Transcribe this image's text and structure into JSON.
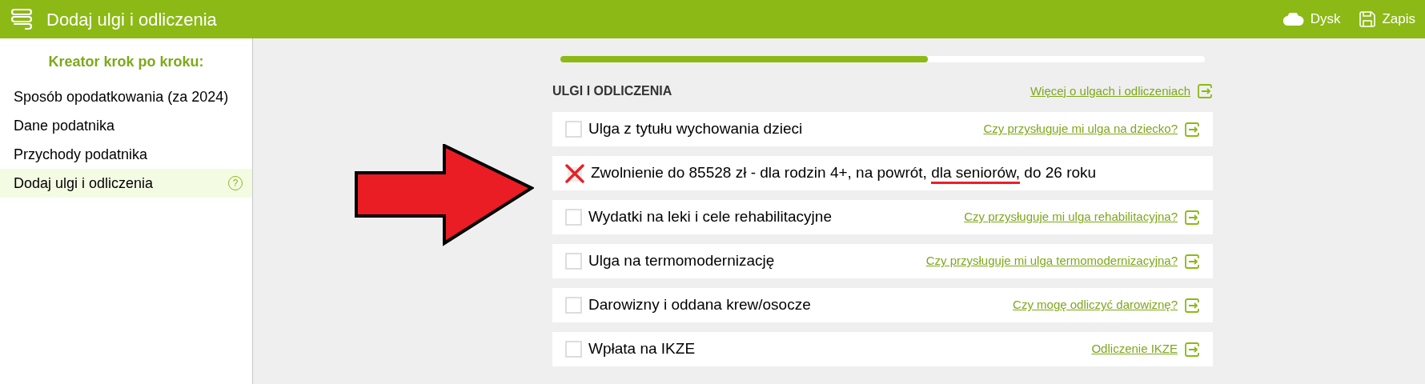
{
  "header": {
    "title": "Dodaj ulgi i odliczenia",
    "actions": [
      {
        "kind": "cloud",
        "label": "Dysk"
      },
      {
        "kind": "save",
        "label": "Zapis"
      }
    ]
  },
  "sidebar": {
    "heading": "Kreator krok po kroku:",
    "items": [
      {
        "label": "Sposób opodatkowania (za 2024)",
        "selected": false
      },
      {
        "label": "Dane podatnika",
        "selected": false
      },
      {
        "label": "Przychody podatnika",
        "selected": false
      },
      {
        "label": "Dodaj ulgi i odliczenia",
        "selected": true,
        "help": "?"
      }
    ]
  },
  "progress": {
    "level": 0.57
  },
  "section": {
    "title": "ULGI I ODLICZENIA",
    "link": "Więcej o ulgach i odliczeniach"
  },
  "rows": [
    {
      "label_parts": [
        {
          "text": "Ulga z tytułu wychowania dzieci",
          "underlined": false
        }
      ],
      "crossed": false,
      "link": "Czy przysługuje mi ulga na dziecko?"
    },
    {
      "label_parts": [
        {
          "text": "Zwolnienie do 85528 zł - dla rodzin 4+, na powrót, ",
          "underlined": false
        },
        {
          "text": "dla seniorów,",
          "underlined": true
        },
        {
          "text": " do 26 roku",
          "underlined": false
        }
      ],
      "crossed": true
    },
    {
      "label_parts": [
        {
          "text": "Wydatki na leki i cele rehabilitacyjne",
          "underlined": false
        }
      ],
      "crossed": false,
      "link": "Czy przysługuje mi ulga rehabilitacyjna?"
    },
    {
      "label_parts": [
        {
          "text": "Ulga na termomodernizację",
          "underlined": false
        }
      ],
      "crossed": false,
      "link": "Czy przysługuje mi ulga termomodernizacyjna?"
    },
    {
      "label_parts": [
        {
          "text": "Darowizny i oddana krew/osocze",
          "underlined": false
        }
      ],
      "crossed": false,
      "link": "Czy mogę odliczyć darowiznę?"
    },
    {
      "label_parts": [
        {
          "text": "Wpłata na IKZE",
          "underlined": false
        }
      ],
      "crossed": false,
      "link": "Odliczenie IKZE"
    }
  ],
  "annotation": {
    "kind": "arrow"
  }
}
